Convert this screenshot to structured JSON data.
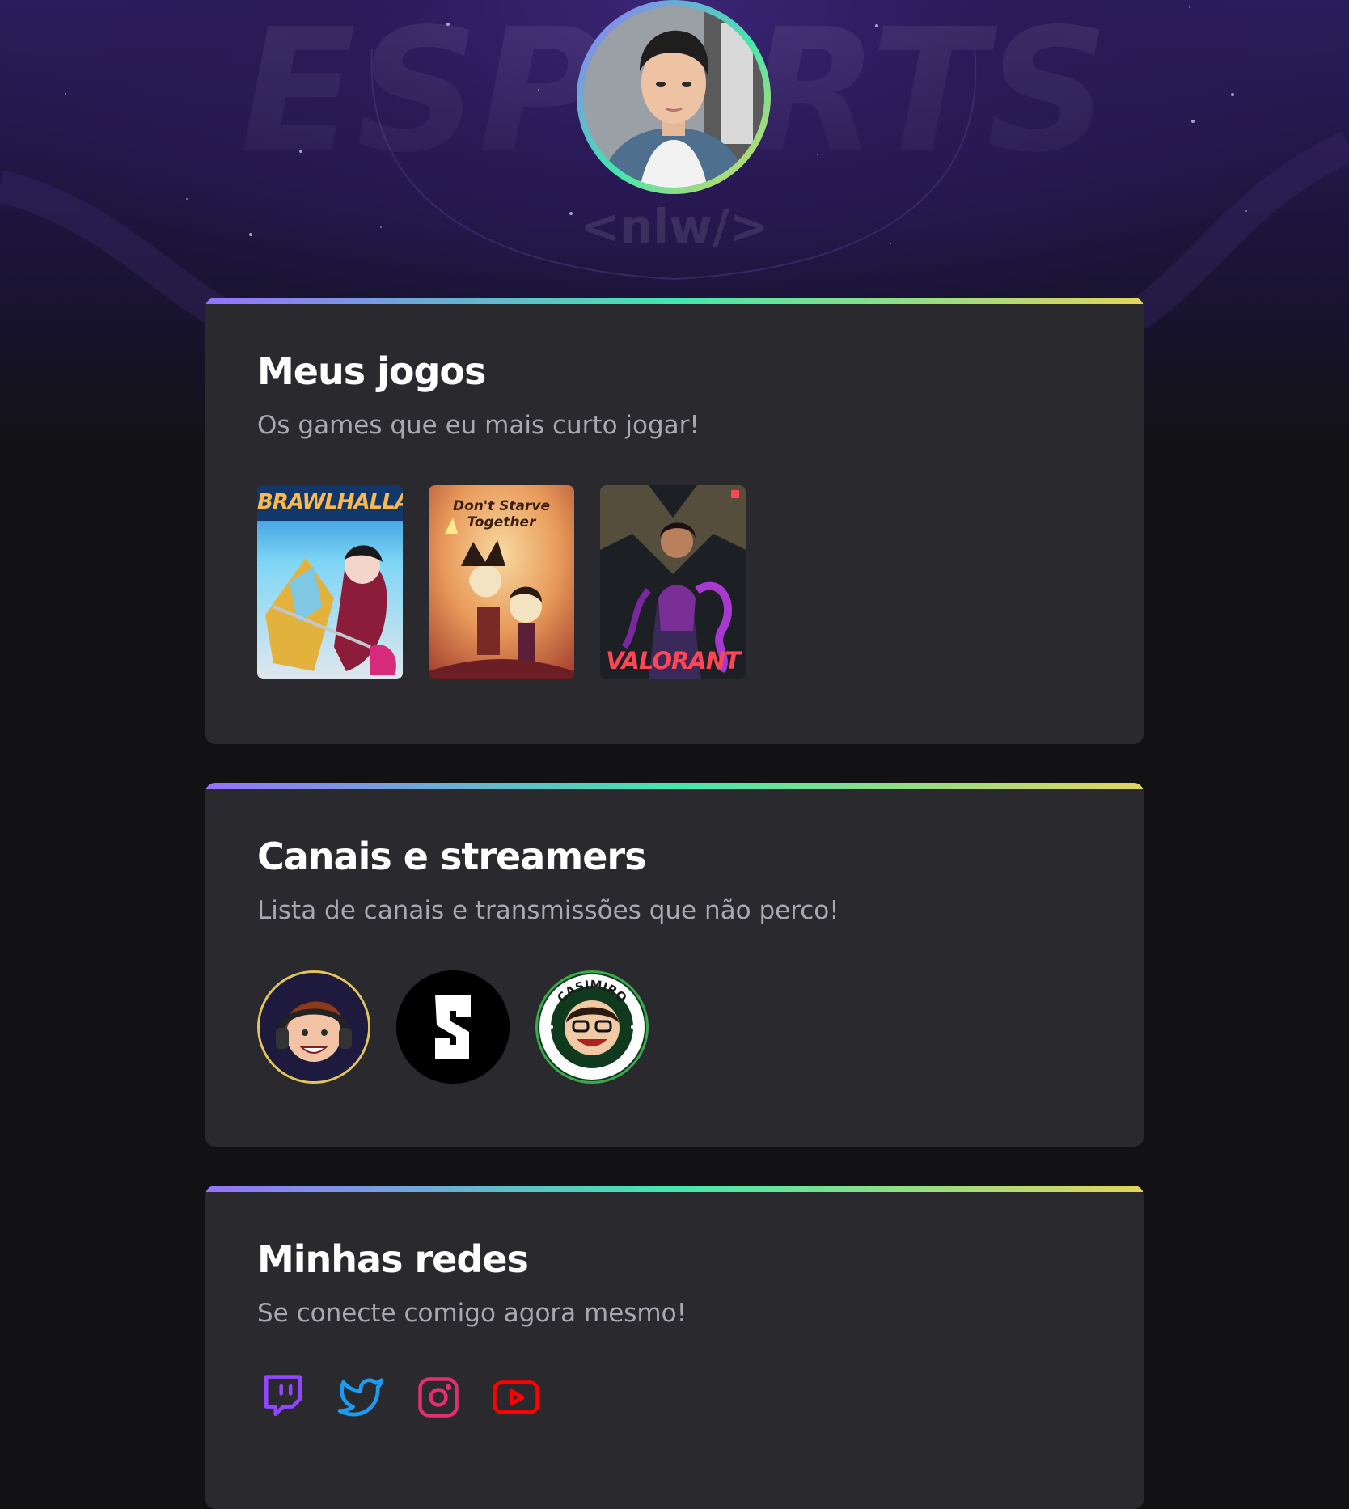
{
  "hero": {
    "background_word": "ESPORTS",
    "background_tag": "<nlw/>",
    "avatar": {
      "alt": "profile-photo"
    }
  },
  "games_section": {
    "title": "Meus jogos",
    "subtitle": "Os games que eu mais curto jogar!",
    "games": [
      {
        "name": "BRAWLHALLA",
        "color": "#2aa7e6"
      },
      {
        "name": "Don't Starve Together",
        "color": "#e0894a"
      },
      {
        "name": "VALORANT",
        "color": "#ff4655"
      }
    ]
  },
  "channels_section": {
    "title": "Canais e streamers",
    "subtitle": "Lista de canais e transmissões que não perco!",
    "channels": [
      {
        "icon": "streamer-avatar-icon"
      },
      {
        "icon": "channel-logo-icon"
      },
      {
        "label": "CASIMIRO",
        "icon": "casimiro-badge-icon"
      }
    ]
  },
  "social_section": {
    "title": "Minhas redes",
    "subtitle": "Se conecte comigo agora mesmo!",
    "links": [
      {
        "icon": "twitch-icon",
        "color": "#9146ff"
      },
      {
        "icon": "twitter-icon",
        "color": "#1d9bf0"
      },
      {
        "icon": "instagram-icon",
        "color": "#e1306c"
      },
      {
        "icon": "youtube-icon",
        "color": "#ff0000"
      }
    ]
  },
  "colors": {
    "gradient": [
      "#9572fc",
      "#43e7ad",
      "#e2d45c"
    ],
    "card": "#29292e",
    "page": "#121214"
  }
}
